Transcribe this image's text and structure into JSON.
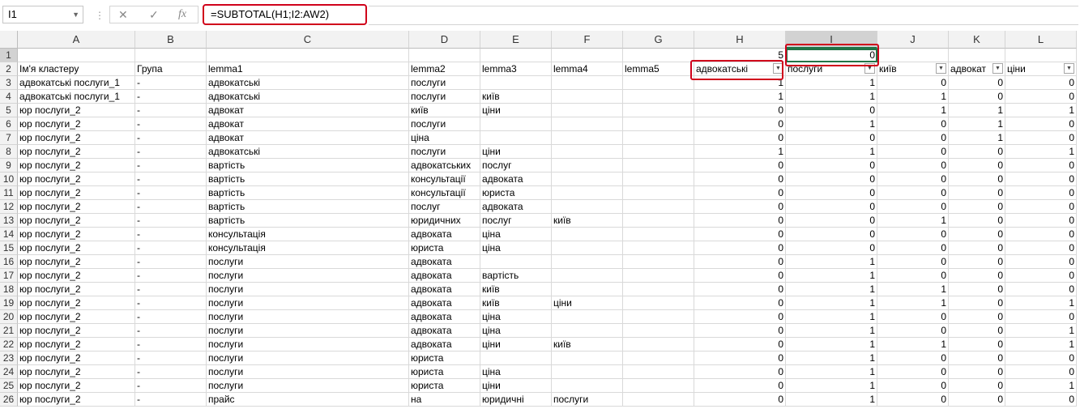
{
  "name_box": "I1",
  "formula": "=SUBTOTAL(H1;I2:AW2)",
  "icons": {
    "cancel": "close-icon",
    "enter": "check-icon",
    "fx": "fx-icon"
  },
  "fx_label": "fx",
  "columns": [
    "A",
    "B",
    "C",
    "D",
    "E",
    "F",
    "G",
    "H",
    "I",
    "J",
    "K",
    "L"
  ],
  "row_numbers": [
    "1",
    "2",
    "3",
    "4",
    "5",
    "6",
    "7",
    "8",
    "9",
    "10",
    "11",
    "12",
    "13",
    "14",
    "15",
    "16",
    "17",
    "18",
    "19",
    "20",
    "21",
    "22",
    "23",
    "24",
    "25",
    "26"
  ],
  "row1": {
    "H": "5",
    "I": "0"
  },
  "headers": [
    "Ім'я кластеру",
    "Група",
    "lemma1",
    "lemma2",
    "lemma3",
    "lemma4",
    "lemma5",
    "адвокатські",
    "послуги",
    "київ",
    "адвокат",
    "ціни"
  ],
  "rows": [
    [
      "адвокатські послуги_1",
      "-",
      "адвокатські",
      "послуги",
      "",
      "",
      "",
      "1",
      "1",
      "0",
      "0",
      "0"
    ],
    [
      "адвокатські послуги_1",
      "-",
      "адвокатські",
      "послуги",
      "київ",
      "",
      "",
      "1",
      "1",
      "1",
      "0",
      "0"
    ],
    [
      "юр послуги_2",
      "-",
      "адвокат",
      "київ",
      "ціни",
      "",
      "",
      "0",
      "0",
      "1",
      "1",
      "1"
    ],
    [
      "юр послуги_2",
      "-",
      "адвокат",
      "послуги",
      "",
      "",
      "",
      "0",
      "1",
      "0",
      "1",
      "0"
    ],
    [
      "юр послуги_2",
      "-",
      "адвокат",
      "ціна",
      "",
      "",
      "",
      "0",
      "0",
      "0",
      "1",
      "0"
    ],
    [
      "юр послуги_2",
      "-",
      "адвокатські",
      "послуги",
      "ціни",
      "",
      "",
      "1",
      "1",
      "0",
      "0",
      "1"
    ],
    [
      "юр послуги_2",
      "-",
      "вартість",
      "адвокатських",
      "послуг",
      "",
      "",
      "0",
      "0",
      "0",
      "0",
      "0"
    ],
    [
      "юр послуги_2",
      "-",
      "вартість",
      "консультації",
      "адвоката",
      "",
      "",
      "0",
      "0",
      "0",
      "0",
      "0"
    ],
    [
      "юр послуги_2",
      "-",
      "вартість",
      "консультації",
      "юриста",
      "",
      "",
      "0",
      "0",
      "0",
      "0",
      "0"
    ],
    [
      "юр послуги_2",
      "-",
      "вартість",
      "послуг",
      "адвоката",
      "",
      "",
      "0",
      "0",
      "0",
      "0",
      "0"
    ],
    [
      "юр послуги_2",
      "-",
      "вартість",
      "юридичних",
      "послуг",
      "київ",
      "",
      "0",
      "0",
      "1",
      "0",
      "0"
    ],
    [
      "юр послуги_2",
      "-",
      "консультація",
      "адвоката",
      "ціна",
      "",
      "",
      "0",
      "0",
      "0",
      "0",
      "0"
    ],
    [
      "юр послуги_2",
      "-",
      "консультація",
      "юриста",
      "ціна",
      "",
      "",
      "0",
      "0",
      "0",
      "0",
      "0"
    ],
    [
      "юр послуги_2",
      "-",
      "послуги",
      "адвоката",
      "",
      "",
      "",
      "0",
      "1",
      "0",
      "0",
      "0"
    ],
    [
      "юр послуги_2",
      "-",
      "послуги",
      "адвоката",
      "вартість",
      "",
      "",
      "0",
      "1",
      "0",
      "0",
      "0"
    ],
    [
      "юр послуги_2",
      "-",
      "послуги",
      "адвоката",
      "київ",
      "",
      "",
      "0",
      "1",
      "1",
      "0",
      "0"
    ],
    [
      "юр послуги_2",
      "-",
      "послуги",
      "адвоката",
      "київ",
      "ціни",
      "",
      "0",
      "1",
      "1",
      "0",
      "1"
    ],
    [
      "юр послуги_2",
      "-",
      "послуги",
      "адвоката",
      "ціна",
      "",
      "",
      "0",
      "1",
      "0",
      "0",
      "0"
    ],
    [
      "юр послуги_2",
      "-",
      "послуги",
      "адвоката",
      "ціна",
      "",
      "",
      "0",
      "1",
      "0",
      "0",
      "1"
    ],
    [
      "юр послуги_2",
      "-",
      "послуги",
      "адвоката",
      "ціни",
      "київ",
      "",
      "0",
      "1",
      "1",
      "0",
      "1"
    ],
    [
      "юр послуги_2",
      "-",
      "послуги",
      "юриста",
      "",
      "",
      "",
      "0",
      "1",
      "0",
      "0",
      "0"
    ],
    [
      "юр послуги_2",
      "-",
      "послуги",
      "юриста",
      "ціна",
      "",
      "",
      "0",
      "1",
      "0",
      "0",
      "0"
    ],
    [
      "юр послуги_2",
      "-",
      "послуги",
      "юриста",
      "ціни",
      "",
      "",
      "0",
      "1",
      "0",
      "0",
      "1"
    ],
    [
      "юр послуги_2",
      "-",
      "прайс",
      "на",
      "юридичні",
      "послуги",
      "",
      "0",
      "1",
      "0",
      "0",
      "0"
    ]
  ],
  "colors": {
    "highlight": "#d0021b",
    "selection": "#217346",
    "header_bg": "#f2f2f2"
  }
}
